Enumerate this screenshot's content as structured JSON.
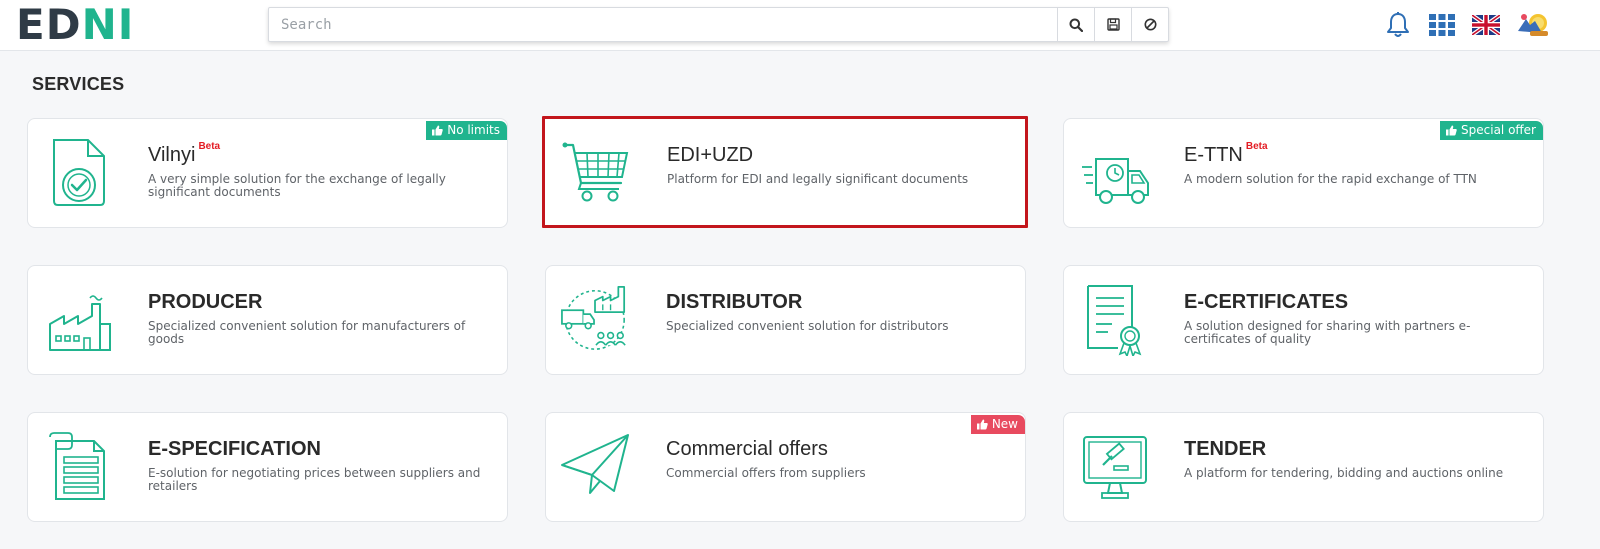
{
  "header": {
    "logo_left": "ED",
    "logo_right": "NI",
    "search_placeholder": "Search",
    "icons": [
      "search-icon",
      "save-icon",
      "clear-icon",
      "bell-icon",
      "apps-grid-icon",
      "uk-flag-icon",
      "avatar"
    ]
  },
  "section": {
    "title": "SERVICES"
  },
  "colors": {
    "accent": "#20b48e",
    "selected_border": "#c3161c",
    "badge_green": "#20b48e",
    "badge_red": "#e84a5f",
    "beta_red": "#e31b23"
  },
  "services": [
    {
      "title": "Vilnyi",
      "tag": "Beta",
      "description": "A very simple solution for the exchange of legally significant documents",
      "badge": "No limits",
      "icon": "document-check-icon",
      "selected": false
    },
    {
      "title": "EDI+UZD",
      "tag": "",
      "description": "Platform for EDI and legally significant documents",
      "badge": "",
      "icon": "shopping-cart-icon",
      "selected": true
    },
    {
      "title": "E-TTN",
      "tag": "Beta",
      "description": "A modern solution for the rapid exchange of TTN",
      "badge": "Special offer",
      "icon": "delivery-truck-icon",
      "selected": false
    },
    {
      "title": "PRODUCER",
      "tag": "",
      "description": "Specialized convenient solution for manufacturers of goods",
      "badge": "",
      "icon": "factory-icon",
      "selected": false
    },
    {
      "title": "DISTRIBUTOR",
      "tag": "",
      "description": "Specialized convenient solution for distributors",
      "badge": "",
      "icon": "distribution-icon",
      "selected": false
    },
    {
      "title": "E-CERTIFICATES",
      "tag": "",
      "description": "A solution designed for sharing with partners e-certificates of quality",
      "badge": "",
      "icon": "certificate-icon",
      "selected": false
    },
    {
      "title": "E-SPECIFICATION",
      "tag": "",
      "description": "E-solution for negotiating prices between suppliers and retailers",
      "badge": "",
      "icon": "specification-document-icon",
      "selected": false
    },
    {
      "title": "Commercial offers",
      "tag": "",
      "description": "Commercial offers from suppliers",
      "badge": "New",
      "icon": "paper-plane-icon",
      "selected": false
    },
    {
      "title": "TENDER",
      "tag": "",
      "description": "A platform for tendering, bidding and auctions online",
      "badge": "",
      "icon": "auction-monitor-icon",
      "selected": false
    }
  ]
}
